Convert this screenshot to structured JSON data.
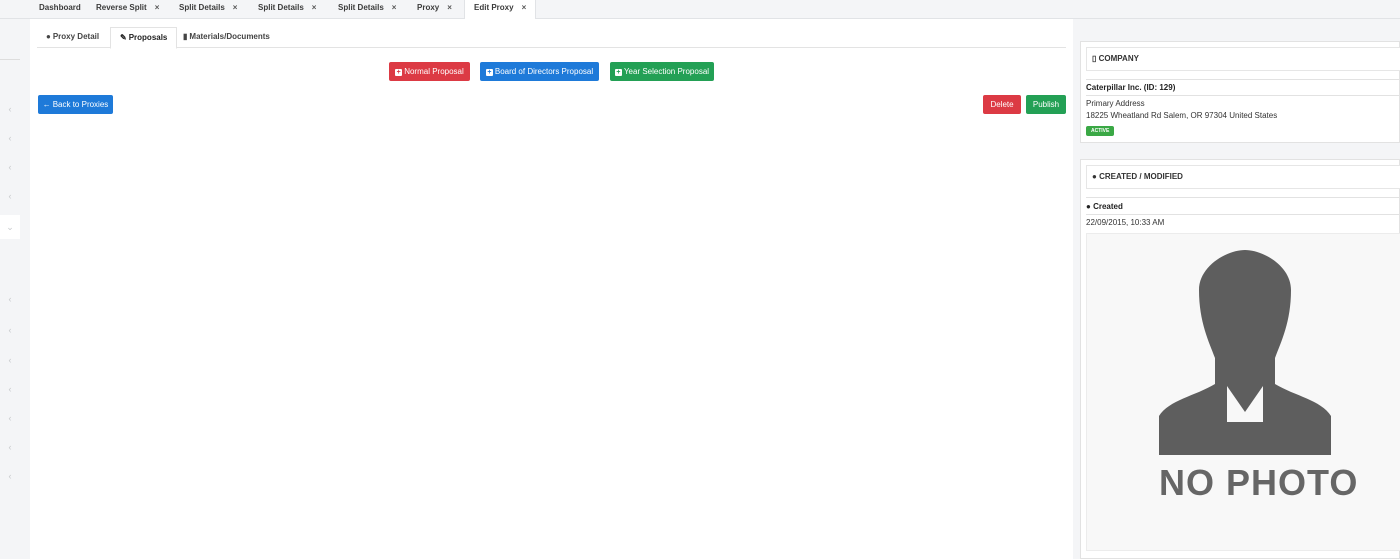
{
  "tabs": [
    {
      "label": "Dashboard",
      "closable": false
    },
    {
      "label": "Reverse Split",
      "closable": true
    },
    {
      "label": "Split Details",
      "closable": true
    },
    {
      "label": "Split Details",
      "closable": true
    },
    {
      "label": "Split Details",
      "closable": true
    },
    {
      "label": "Proxy",
      "closable": true
    },
    {
      "label": "Edit Proxy",
      "closable": true,
      "active": true
    }
  ],
  "close_glyph": "×",
  "subtabs": {
    "proxy_detail": "Proxy Detail",
    "proposals": "Proposals",
    "materials": "Materials/Documents"
  },
  "actions": {
    "normal_proposal": "Normal Proposal",
    "board_proposal": "Board of Directors Proposal",
    "year_selection_proposal": "Year Selection Proposal",
    "back": "Back to Proxies",
    "delete": "Delete",
    "publish": "Publish"
  },
  "company": {
    "header": "COMPANY",
    "name": "Caterpillar Inc. (ID: 129)",
    "address_label": "Primary Address",
    "address": "18225 Wheatland Rd Salem, OR 97304 United States",
    "status": "ACTIVE"
  },
  "created_modified": {
    "header": "CREATED / MODIFIED",
    "created_label": "Created",
    "created_value": "22/09/2015, 10:33 AM",
    "photo_text": "NO PHOTO"
  },
  "colors": {
    "red": "#dc3a44",
    "blue": "#1e7ad9",
    "green": "#23a055",
    "active_badge": "#3aa845"
  },
  "icons": [
    "info-icon",
    "wrench-icon",
    "document-icon",
    "plus-square-icon",
    "arrow-left-icon",
    "building-icon",
    "user-icon",
    "chevron-left-icon",
    "chevron-down-icon"
  ]
}
